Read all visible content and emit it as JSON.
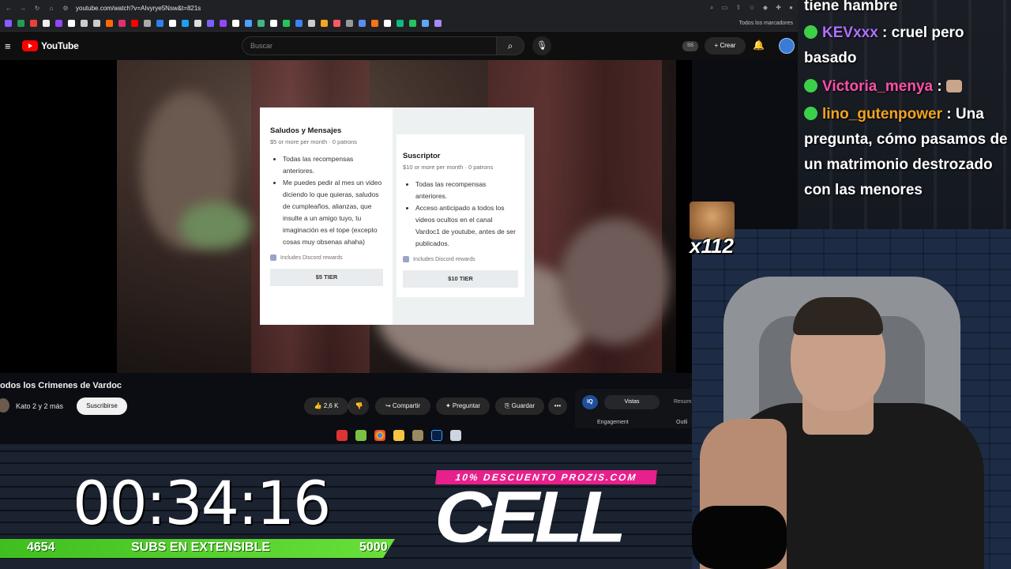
{
  "browser": {
    "url": "youtube.com/watch?v=AIvyrye5Nsw&t=821s",
    "bookmarks_folder": "Todos los marcadores"
  },
  "youtube": {
    "logo_text": "YouTube",
    "search_placeholder": "Buscar",
    "badge_ss": "SS",
    "create_label": "+ Crear"
  },
  "patreon": {
    "tiers": [
      {
        "name": "Saludos y Mensajes",
        "price_line": "$5 or more per month · 0 patrons",
        "perks": [
          "Todas las recompensas anteriores.",
          "Me puedes pedir al mes un video diciendo lo que quieras, saludos de cumpleaños, alianzas, que insulte a un amigo tuyo, tu imaginación es el tope (excepto cosas muy obsenas ahaha)"
        ],
        "discord": "Includes Discord rewards",
        "button": "$5 TIER"
      },
      {
        "name": "Suscriptor",
        "price_line": "$10 or more per month · 0 patrons",
        "perks": [
          "Todas las recompensas anteriores.",
          "Acceso anticipado a todos los videos ocultos en el canal Vardoc1 de youtube, antes de ser publicados."
        ],
        "discord": "Includes Discord rewards",
        "button": "$10 TIER"
      }
    ]
  },
  "video": {
    "title": "odos los Crimenes de Vardoc",
    "channel_line": "Kato 2 y 2 más",
    "subscribe": "Suscribirse",
    "likes": "2,6 K",
    "share": "Compartir",
    "ask": "Preguntar",
    "save": "Guardar",
    "more": "•••"
  },
  "stats_panel": {
    "iq": "IQ",
    "tab_views": "Vistas",
    "tab_summary": "Resum",
    "engagement": "Engagement",
    "outline": "Outli"
  },
  "overlay": {
    "timer": "00:34:16",
    "subs_current": "4654",
    "subs_label": "SUBS EN EXTENSIBLE",
    "subs_goal": "5000",
    "promo": "10% DESCUENTO PROZIS.COM",
    "brand": "CELL",
    "emote_count": "x112"
  },
  "chat": [
    {
      "user": "",
      "text": "tiene hambre",
      "user_color": "#ffffff"
    },
    {
      "user": "KEVxxx",
      "text": " : cruel pero basado",
      "user_color": "#b070ff"
    },
    {
      "user": "Victoria_menya",
      "text": " : ",
      "user_color": "#ff4fa8"
    },
    {
      "user": "lino_gutenpower",
      "text": " : Una pregunta, cómo pasamos de un matrimonio destrozado con las menores",
      "user_color": "#f3a320"
    }
  ],
  "colors": {
    "youtube_red": "#ff0000",
    "sub_bar": "#4fcf25",
    "promo_pink": "#e8208c"
  }
}
